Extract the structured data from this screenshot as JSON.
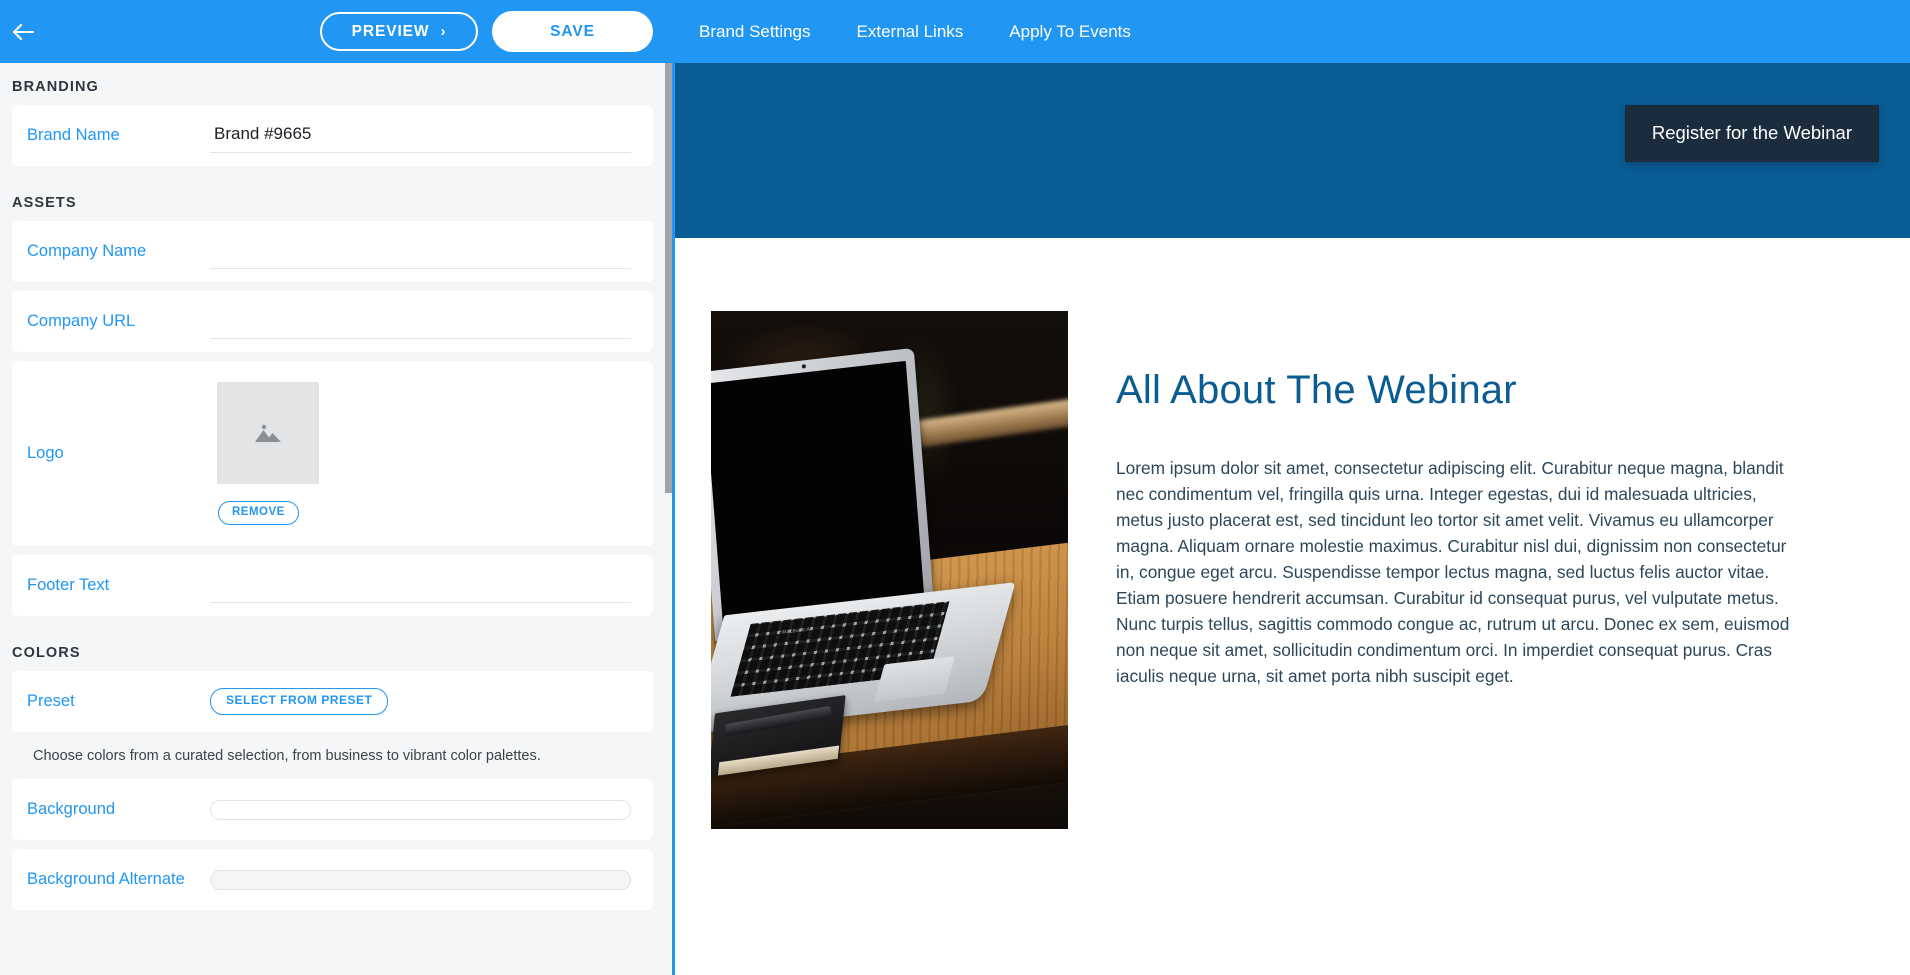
{
  "topbar": {
    "back_icon": "arrow-left-icon",
    "preview_label": "PREVIEW",
    "preview_chevron": "›",
    "save_label": "SAVE",
    "nav": [
      {
        "label": "Brand Settings"
      },
      {
        "label": "External Links"
      },
      {
        "label": "Apply To Events"
      }
    ],
    "accent_color": "#2196f3"
  },
  "sidebar": {
    "sections": [
      {
        "title": "BRANDING",
        "fields": [
          {
            "label": "Brand Name",
            "value": "Brand #9665",
            "placeholder": ""
          }
        ]
      },
      {
        "title": "ASSETS",
        "fields": [
          {
            "label": "Company Name",
            "value": "",
            "placeholder": ""
          },
          {
            "label": "Company URL",
            "value": "",
            "placeholder": ""
          },
          {
            "label": "Logo",
            "remove_label": "REMOVE",
            "thumb_icon": "image-placeholder-icon"
          },
          {
            "label": "Footer Text",
            "value": "",
            "placeholder": ""
          }
        ]
      },
      {
        "title": "COLORS",
        "fields": [
          {
            "label": "Preset",
            "button_label": "SELECT FROM PRESET"
          },
          {
            "helper": "Choose colors from a curated selection, from business to vibrant color palettes."
          },
          {
            "label": "Background",
            "swatch_color": "#ffffff"
          },
          {
            "label": "Background Alternate",
            "swatch_color": "#f4f5f6"
          }
        ]
      }
    ]
  },
  "preview": {
    "banner_color": "#0a5c94",
    "register_button": {
      "label": "Register for the Webinar",
      "bg_color": "#1a2c3d",
      "text_color": "#ffffff"
    },
    "photo_alt": "macbook-on-wooden-desk-photo",
    "title": "All About The Webinar",
    "title_color": "#0b5c93",
    "body": "Lorem ipsum dolor sit amet, consectetur adipiscing elit. Curabitur neque magna, blandit nec condimentum vel, fringilla quis urna. Integer egestas, dui id malesuada ultricies, metus justo placerat est, sed tincidunt leo tortor sit amet velit. Vivamus eu ullamcorper magna. Aliquam ornare molestie maximus. Curabitur nisl dui, dignissim non consectetur in, congue eget arcu. Suspendisse tempor lectus magna, sed luctus felis auctor vitae. Etiam posuere hendrerit accumsan. Curabitur id consequat purus, vel vulputate metus. Nunc turpis tellus, sagittis commodo congue ac, rutrum ut arcu. Donec ex sem, euismod non neque sit amet, sollicitudin condimentum orci. In imperdiet consequat purus. Cras iaculis neque urna, sit amet porta nibh suscipit eget."
  }
}
